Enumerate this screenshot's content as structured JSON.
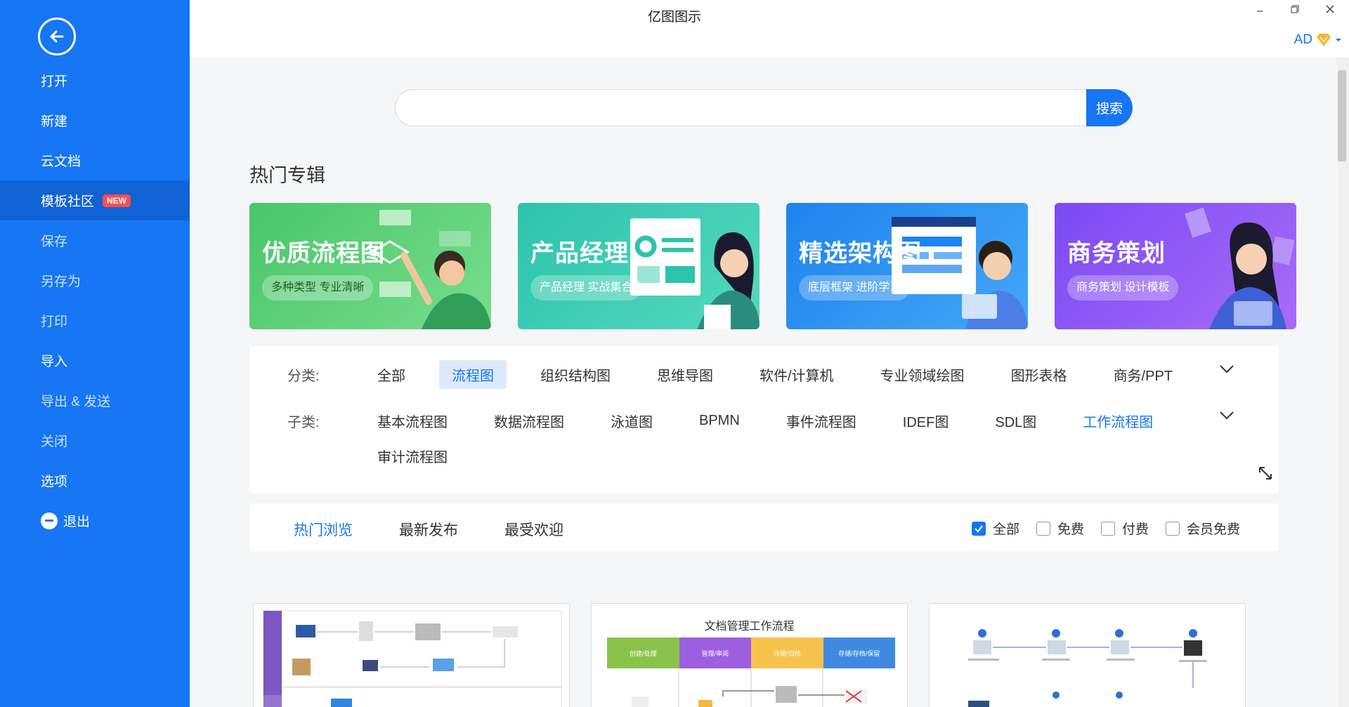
{
  "app": {
    "title": "亿图图示",
    "user": "AD"
  },
  "sidebar": {
    "items": [
      {
        "label": "打开"
      },
      {
        "label": "新建"
      },
      {
        "label": "云文档"
      },
      {
        "label": "模板社区",
        "badge": "NEW"
      },
      {
        "label": "保存"
      },
      {
        "label": "另存为"
      },
      {
        "label": "打印"
      },
      {
        "label": "导入"
      },
      {
        "label": "导出 & 发送"
      },
      {
        "label": "关闭"
      },
      {
        "label": "选项"
      },
      {
        "label": "退出"
      }
    ]
  },
  "search": {
    "placeholder": "",
    "button": "搜索"
  },
  "hot": {
    "title": "热门专辑",
    "banners": [
      {
        "title": "优质流程图",
        "subtitle": "多种类型 专业清晰"
      },
      {
        "title": "产品经理",
        "subtitle": "产品经理 实战集合"
      },
      {
        "title": "精选架构图",
        "subtitle": "底层框架 进阶学习"
      },
      {
        "title": "商务策划",
        "subtitle": "商务策划 设计模板"
      }
    ]
  },
  "category": {
    "label": "分类:",
    "items": [
      "全部",
      "流程图",
      "组织结构图",
      "思维导图",
      "软件/计算机",
      "专业领域绘图",
      "图形表格",
      "商务/PPT"
    ],
    "selected": "流程图"
  },
  "subcategory": {
    "label": "子类:",
    "items": [
      "基本流程图",
      "数据流程图",
      "泳道图",
      "BPMN",
      "事件流程图",
      "IDEF图",
      "SDL图",
      "工作流程图",
      "审计流程图"
    ],
    "highlighted": "工作流程图"
  },
  "tabs": {
    "items": [
      "热门浏览",
      "最新发布",
      "最受欢迎"
    ],
    "active": "热门浏览"
  },
  "filters": [
    {
      "label": "全部",
      "checked": true
    },
    {
      "label": "免费",
      "checked": false
    },
    {
      "label": "付费",
      "checked": false
    },
    {
      "label": "会员免费",
      "checked": false
    }
  ],
  "cards": {
    "card2": {
      "title": "文档管理工作流程",
      "lanes": [
        "创建/处理",
        "管理/审阅",
        "存储/归档",
        "存储/存档/保留"
      ]
    }
  },
  "colors": {
    "accent": "#1676f3"
  }
}
